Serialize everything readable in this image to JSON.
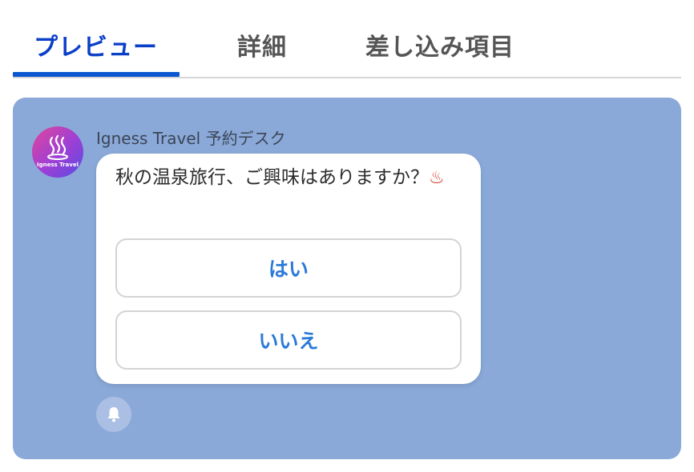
{
  "tabs": [
    {
      "label": "プレビュー",
      "active": true
    },
    {
      "label": "詳細",
      "active": false
    },
    {
      "label": "差し込み項目",
      "active": false
    }
  ],
  "colors": {
    "active_tab": "#0a3fc7",
    "panel_background": "#8aa9d8",
    "reply_text": "#2b7ad8"
  },
  "chat": {
    "avatar_label": "Igness Travel",
    "avatar_icon": "hot-springs-icon",
    "sender_name": "Igness Travel 予約デスク",
    "message_text": "秋の温泉旅行、ご興味はありますか？",
    "message_emoji": "♨",
    "quick_replies": [
      "はい",
      "いいえ"
    ],
    "notification_icon": "bell-icon"
  }
}
